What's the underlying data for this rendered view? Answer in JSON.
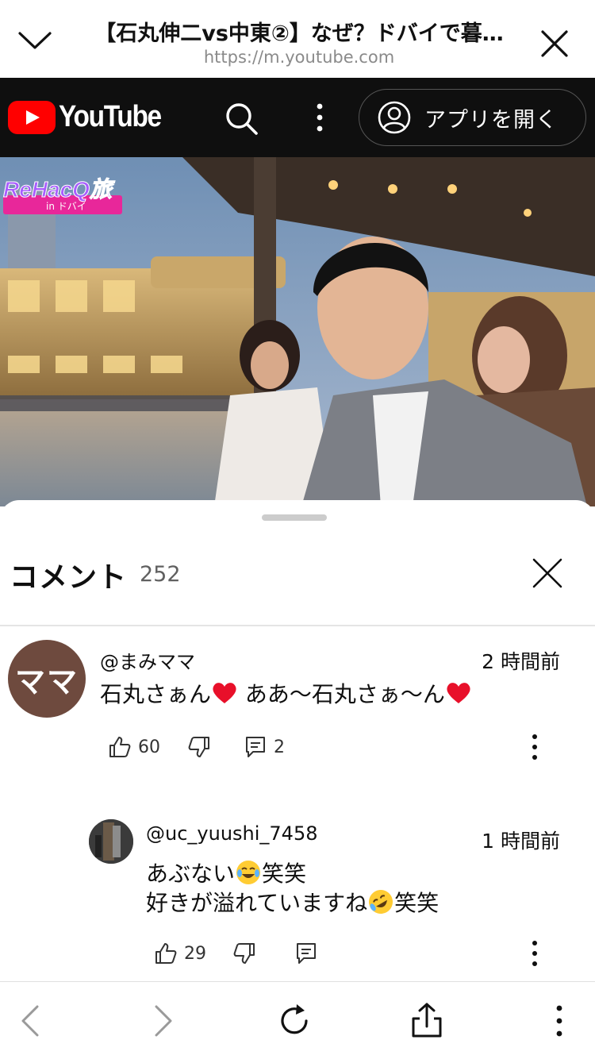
{
  "browser": {
    "title": "【石丸伸二vs中東②】なぜ？ドバイで暮…",
    "url": "https://m.youtube.com"
  },
  "header": {
    "logo_text": "YouTube",
    "open_app_label": "アプリを開く"
  },
  "video": {
    "overlay_logo": "ReHacQ旅",
    "overlay_sub": "in ドバイ"
  },
  "comments": {
    "title": "コメント",
    "count": "252",
    "items": [
      {
        "author": "@まみママ",
        "avatar_text": "ママ",
        "time": "2 時間前",
        "text_a": "石丸さぁん",
        "text_b": " ああ〜石丸さぁ〜ん",
        "likes": "60",
        "replies": "2"
      },
      {
        "author": "@uc_yuushi_7458",
        "time": "1 時間前",
        "line1_a": "あぶない",
        "line1_b": "笑笑",
        "line2_a": "好きが溢れていますね",
        "line2_b": "笑笑",
        "likes": "29"
      }
    ]
  },
  "colors": {
    "yt_red": "#ff0000",
    "header_bg": "#0f0f0f",
    "avatar_bg": "#6e4a3e"
  },
  "icons": [
    "chevron-down-icon",
    "close-icon",
    "search-icon",
    "more-vert-icon",
    "account-circle-icon",
    "like-icon",
    "dislike-icon",
    "reply-icon",
    "back-icon",
    "forward-icon",
    "reload-icon",
    "share-icon"
  ]
}
